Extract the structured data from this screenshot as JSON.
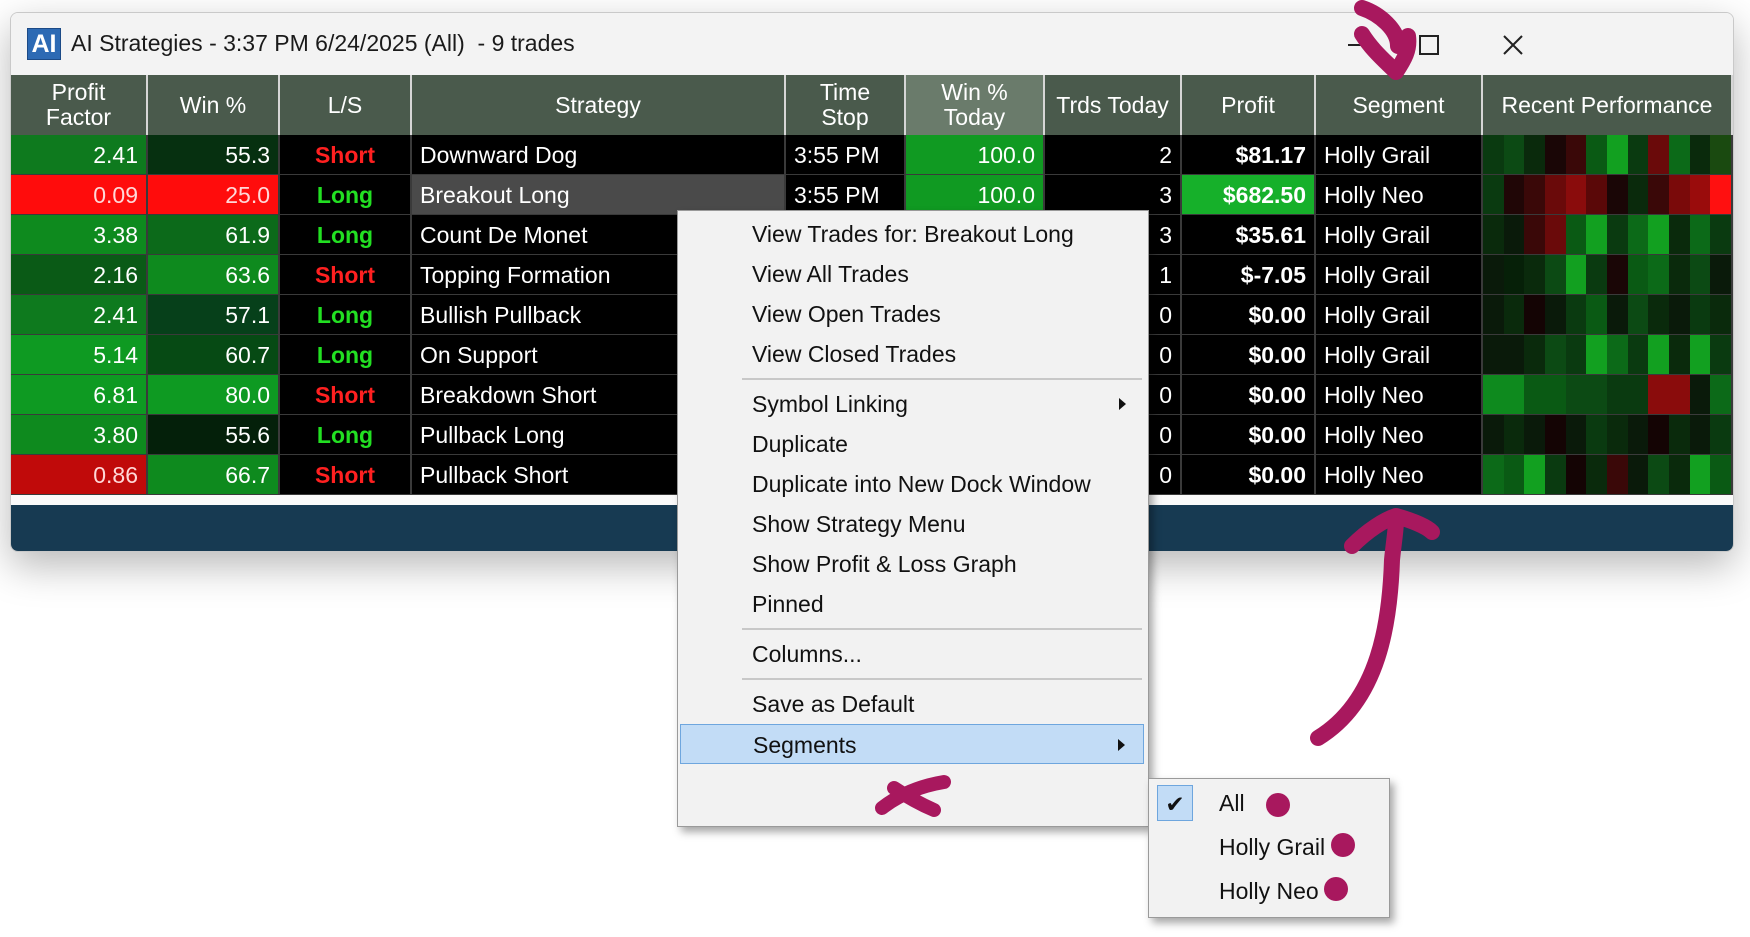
{
  "window": {
    "app_icon": "AI",
    "title": "AI Strategies - 3:37 PM 6/24/2025 (All)  - 9 trades",
    "controls": [
      "minimize-icon",
      "maximize-icon",
      "close-icon"
    ]
  },
  "columns": [
    "Profit\nFactor",
    "Win %",
    "L/S",
    "Strategy",
    "Time\nStop",
    "Win %\nToday",
    "Trds Today",
    "Profit",
    "Segment",
    "Recent Performance"
  ],
  "rows": [
    {
      "pf": "2.41",
      "win": "55.3",
      "ls": "Short",
      "strategy": "Downward Dog",
      "time": "3:55 PM",
      "wintoday": "100.0",
      "trds": "2",
      "profit": "$81.17",
      "segment": "Holly Grail"
    },
    {
      "pf": "0.09",
      "win": "25.0",
      "ls": "Long",
      "strategy": "Breakout Long",
      "time": "3:55 PM",
      "wintoday": "100.0",
      "trds": "3",
      "profit": "$682.50",
      "segment": "Holly Neo"
    },
    {
      "pf": "3.38",
      "win": "61.9",
      "ls": "Long",
      "strategy": "Count De Monet",
      "time": "",
      "wintoday": "",
      "trds": "3",
      "profit": "$35.61",
      "segment": "Holly Grail"
    },
    {
      "pf": "2.16",
      "win": "63.6",
      "ls": "Short",
      "strategy": "Topping Formation",
      "time": "",
      "wintoday": "",
      "trds": "1",
      "profit": "$-7.05",
      "segment": "Holly Grail"
    },
    {
      "pf": "2.41",
      "win": "57.1",
      "ls": "Long",
      "strategy": "Bullish Pullback",
      "time": "",
      "wintoday": "",
      "trds": "0",
      "profit": "$0.00",
      "segment": "Holly Grail"
    },
    {
      "pf": "5.14",
      "win": "60.7",
      "ls": "Long",
      "strategy": "On Support",
      "time": "",
      "wintoday": "",
      "trds": "0",
      "profit": "$0.00",
      "segment": "Holly Grail"
    },
    {
      "pf": "6.81",
      "win": "80.0",
      "ls": "Short",
      "strategy": "Breakdown Short",
      "time": "",
      "wintoday": "",
      "trds": "0",
      "profit": "$0.00",
      "segment": "Holly Neo"
    },
    {
      "pf": "3.80",
      "win": "55.6",
      "ls": "Long",
      "strategy": "Pullback Long",
      "time": "",
      "wintoday": "",
      "trds": "0",
      "profit": "$0.00",
      "segment": "Holly Neo"
    },
    {
      "pf": "0.86",
      "win": "66.7",
      "ls": "Short",
      "strategy": "Pullback Short",
      "time": "",
      "wintoday": "",
      "trds": "0",
      "profit": "$0.00",
      "segment": "Holly Neo"
    }
  ],
  "context_menu": {
    "groups": [
      [
        "View Trades for: Breakout Long",
        "View All Trades",
        "View Open Trades",
        "View Closed Trades"
      ],
      [
        "Symbol Linking",
        "Duplicate",
        "Duplicate into New Dock Window",
        "Show Strategy Menu",
        "Show Profit & Loss Graph",
        "Pinned"
      ],
      [
        "Columns..."
      ],
      [
        "Save as Default",
        "Segments"
      ]
    ],
    "submenu_items": [
      "Symbol Linking",
      "Segments"
    ],
    "highlighted": "Segments"
  },
  "segments_submenu": {
    "items": [
      "All",
      "Holly Grail",
      "Holly Neo"
    ],
    "checked": "All"
  },
  "colors": {
    "header_bg": "#4a5a4c",
    "short_text": "#ff2020",
    "long_text": "#22e022",
    "annotation": "#a8185e",
    "menu_highlight": "#c2dcf6"
  }
}
